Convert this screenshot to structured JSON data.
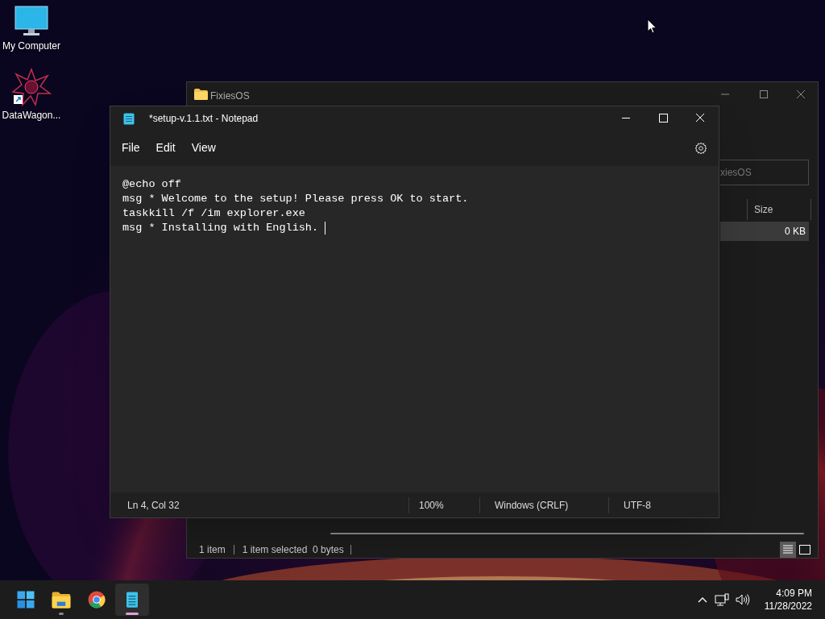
{
  "desktop_icons": [
    {
      "label": "My Computer",
      "kind": "computer"
    },
    {
      "label": "DataWagon...",
      "kind": "shortcut"
    }
  ],
  "explorer": {
    "title": "FixiesOS",
    "search": {
      "placeholder": "xiesOS"
    },
    "columns": [
      "Size"
    ],
    "rows": [
      {
        "size": "0 KB",
        "selected": true
      }
    ],
    "status": [
      "1 item",
      "1 item selected  0 bytes"
    ],
    "views": [
      {
        "kind": "details",
        "selected": true
      },
      {
        "kind": "tiles",
        "selected": false
      }
    ]
  },
  "notepad": {
    "title": "*setup-v.1.1.txt - Notepad",
    "menu": [
      "File",
      "Edit",
      "View"
    ],
    "lines": [
      "@echo off",
      "msg * Welcome to the setup! Please press OK to start.",
      "taskkill /f /im explorer.exe",
      "msg * Installing with English."
    ],
    "status": [
      "Ln 4, Col 32",
      "100%",
      "Windows (CRLF)",
      "UTF-8"
    ]
  },
  "taskbar": {
    "apps": [
      {
        "kind": "start",
        "open": false,
        "active": false
      },
      {
        "kind": "explorer",
        "open": true,
        "active": false
      },
      {
        "kind": "chrome",
        "open": false,
        "active": false
      },
      {
        "kind": "notepad",
        "open": true,
        "active": true
      }
    ],
    "time": "4:09 PM",
    "date": "11/28/2022"
  }
}
